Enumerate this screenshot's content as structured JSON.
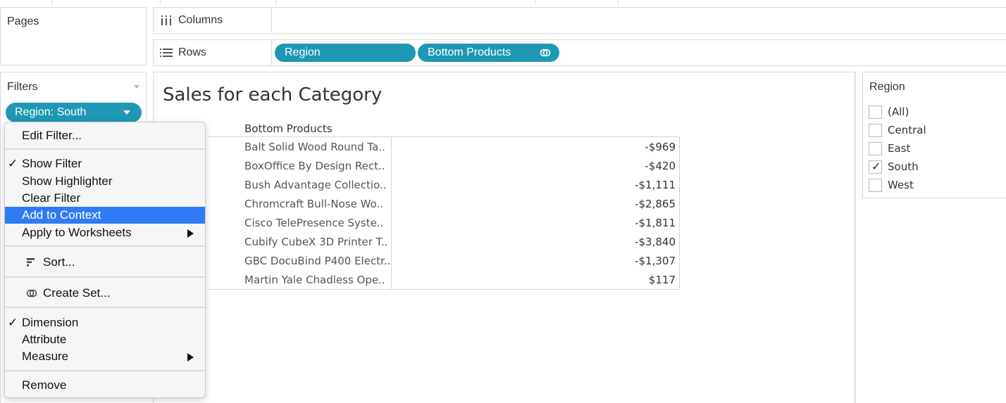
{
  "pages_card": {
    "title": "Pages"
  },
  "columns_shelf": {
    "label": "Columns",
    "icon": "columns-icon"
  },
  "rows_shelf": {
    "label": "Rows",
    "icon": "rows-icon",
    "pills": [
      {
        "label": "Region"
      },
      {
        "label": "Bottom Products",
        "icon": "set-icon"
      }
    ]
  },
  "filters_card": {
    "title": "Filters",
    "pill_label": "Region: South"
  },
  "context_menu": {
    "edit_filter": "Edit Filter...",
    "show_filter": "Show Filter",
    "show_highlighter": "Show Highlighter",
    "clear_filter": "Clear Filter",
    "add_to_context": "Add to Context",
    "apply_to_worksheets": "Apply to Worksheets",
    "sort": "Sort...",
    "create_set": "Create Set...",
    "dimension": "Dimension",
    "attribute": "Attribute",
    "measure": "Measure",
    "remove": "Remove",
    "check_mark": "✓",
    "highlight_color": "#2e7bf5"
  },
  "view": {
    "title": "Sales for each Category",
    "column_header": "Bottom Products",
    "rows": [
      {
        "product": "Balt Solid Wood Round Ta..",
        "value": "-$969"
      },
      {
        "product": "BoxOffice By Design Rect..",
        "value": "-$420"
      },
      {
        "product": "Bush Advantage Collectio..",
        "value": "-$1,111"
      },
      {
        "product": "Chromcraft Bull-Nose Wo..",
        "value": "-$2,865"
      },
      {
        "product": "Cisco TelePresence Syste..",
        "value": "-$1,811"
      },
      {
        "product": "Cubify CubeX 3D Printer T..",
        "value": "-$3,840"
      },
      {
        "product": "GBC DocuBind P400 Electr..",
        "value": "-$1,307"
      },
      {
        "product": "Martin Yale Chadless Ope..",
        "value": "$117"
      }
    ]
  },
  "region_filter": {
    "title": "Region",
    "options": [
      {
        "label": "(All)",
        "checked": false
      },
      {
        "label": "Central",
        "checked": false
      },
      {
        "label": "East",
        "checked": false
      },
      {
        "label": "South",
        "checked": true
      },
      {
        "label": "West",
        "checked": false
      }
    ],
    "check_mark": "✓"
  },
  "colors": {
    "pill": "#1e98b4",
    "menu_highlight": "#2e7bf5"
  }
}
